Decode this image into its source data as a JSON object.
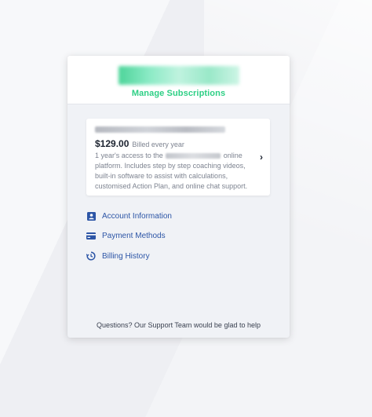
{
  "header": {
    "manage_title": "Manage Subscriptions"
  },
  "subscription": {
    "price": "$129.00",
    "billed": "Billed every year",
    "desc_part1": "1 year's access to the",
    "desc_part2": "online platform. Includes step by step coaching videos, built-in software to assist with calculations, customised Action Plan, and online chat support.",
    "chevron": "›"
  },
  "menu": {
    "items": [
      {
        "label": "Account Information",
        "icon": "account-icon"
      },
      {
        "label": "Payment Methods",
        "icon": "credit-card-icon"
      },
      {
        "label": "Billing History",
        "icon": "history-icon"
      }
    ]
  },
  "footer": {
    "support_text": "Questions? Our Support Team would be glad to help"
  },
  "colors": {
    "accent_green": "#2ecf85",
    "link_blue": "#2c55a6"
  }
}
